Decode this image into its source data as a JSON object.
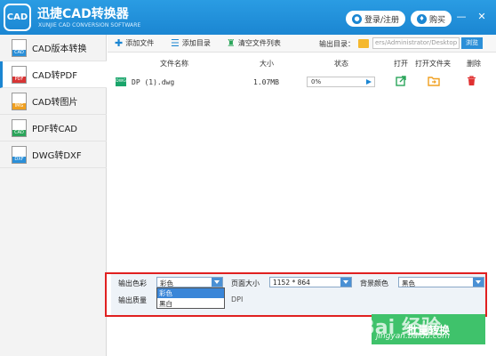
{
  "app": {
    "logo_text": "CAD",
    "title": "迅捷CAD转换器",
    "subtitle": "XUNJIE CAD CONVERSION SOFTWARE",
    "login_label": "登录/注册",
    "buy_label": "购买",
    "minimize": "—",
    "close": "✕"
  },
  "sidebar": {
    "items": [
      {
        "label": "CAD版本转换",
        "icon": "cad-version-icon"
      },
      {
        "label": "CAD转PDF",
        "icon": "cad-pdf-icon"
      },
      {
        "label": "CAD转图片",
        "icon": "cad-image-icon"
      },
      {
        "label": "PDF转CAD",
        "icon": "pdf-cad-icon"
      },
      {
        "label": "DWG转DXF",
        "icon": "dwg-dxf-icon"
      }
    ]
  },
  "toolbar": {
    "add_file": "添加文件",
    "add_folder": "添加目录",
    "clear_list": "清空文件列表",
    "output_label": "输出目录：",
    "output_path": "ers/Administrator/Desktop",
    "browse": "浏览"
  },
  "table": {
    "headers": {
      "name": "文件名称",
      "size": "大小",
      "status": "状态",
      "open": "打开",
      "open_folder": "打开文件夹",
      "delete": "删除"
    },
    "rows": [
      {
        "badge": "DWG",
        "name": "DP (1).dwg",
        "size": "1.07MB",
        "progress_text": "0%",
        "progress": 0
      }
    ]
  },
  "settings": {
    "color_label": "输出色彩",
    "color_value": "彩色",
    "page_size_label": "页面大小",
    "page_size_value": "1152 * 864",
    "bg_label": "背景颜色",
    "bg_value": "黑色",
    "quality_label": "输出质量",
    "dpi_label": "DPI",
    "dropdown_options": [
      "彩色",
      "黑白"
    ]
  },
  "bottom": {
    "convert_label": "批量转换",
    "watermark": "Bai 经验",
    "watermark_url": "jingyan.baidu.com"
  },
  "colors": {
    "accent": "#1b86d2",
    "convert": "#3fc26b",
    "highlight_frame": "#e02020"
  }
}
